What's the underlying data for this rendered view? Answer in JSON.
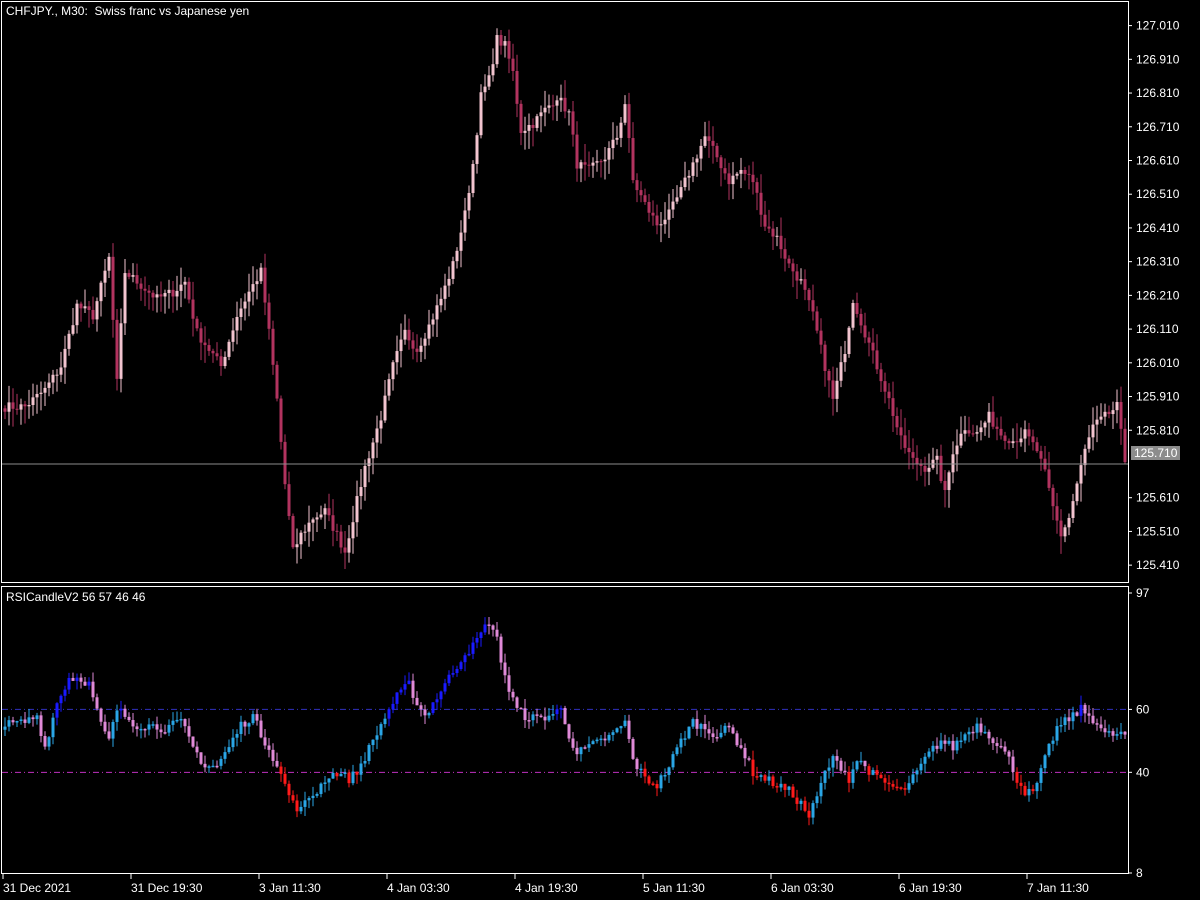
{
  "window": {
    "symbol_label": "CHFJPY., M30:  Swiss franc vs Japanese yen",
    "indicator_label": "RSICandleV2 56 57 46 46",
    "current_price": "125.710",
    "current_price_value": 125.71
  },
  "colors": {
    "background": "#000000",
    "frame": "#ffffff",
    "bull_price": "#f2c4cf",
    "bear_price": "#b2335f",
    "price_line": "#8c8c8c",
    "price_tag_bg": "#8c8c8c",
    "rsi_strong_up": "#1a1aff",
    "rsi_up": "#2aa6e6",
    "rsi_down": "#e08ad8",
    "rsi_strong_down": "#ff1a1a",
    "level_upper": "#3030c0",
    "level_lower": "#c030c0"
  },
  "time_axis": [
    "31 Dec 2021",
    "31 Dec 19:30",
    "3 Jan 11:30",
    "4 Jan 03:30",
    "4 Jan 19:30",
    "5 Jan 11:30",
    "6 Jan 03:30",
    "6 Jan 19:30",
    "7 Jan 11:30"
  ],
  "chart_data": [
    {
      "type": "candlestick",
      "title": "CHFJPY., M30:  Swiss franc vs Japanese yen",
      "y_ticks": [
        "127.010",
        "126.910",
        "126.810",
        "126.710",
        "126.610",
        "126.510",
        "126.410",
        "126.310",
        "126.210",
        "126.110",
        "126.010",
        "125.910",
        "125.810",
        "125.610",
        "125.510",
        "125.410"
      ],
      "ylim": [
        125.36,
        127.08
      ],
      "x_ticks": [
        "31 Dec 2021",
        "31 Dec 19:30",
        "3 Jan 11:30",
        "4 Jan 03:30",
        "4 Jan 19:30",
        "5 Jan 11:30",
        "6 Jan 03:30",
        "6 Jan 19:30",
        "7 Jan 11:30"
      ],
      "close_anchors": [
        [
          0,
          125.88
        ],
        [
          5,
          125.88
        ],
        [
          10,
          125.93
        ],
        [
          14,
          126.0
        ],
        [
          18,
          126.18
        ],
        [
          22,
          126.15
        ],
        [
          26,
          126.32
        ],
        [
          28,
          125.95
        ],
        [
          30,
          126.28
        ],
        [
          33,
          126.25
        ],
        [
          38,
          126.2
        ],
        [
          42,
          126.22
        ],
        [
          45,
          126.25
        ],
        [
          48,
          126.1
        ],
        [
          51,
          126.05
        ],
        [
          54,
          126.0
        ],
        [
          58,
          126.15
        ],
        [
          61,
          126.22
        ],
        [
          64,
          126.28
        ],
        [
          66,
          126.1
        ],
        [
          68,
          125.9
        ],
        [
          70,
          125.65
        ],
        [
          72,
          125.45
        ],
        [
          74,
          125.5
        ],
        [
          77,
          125.55
        ],
        [
          80,
          125.57
        ],
        [
          83,
          125.5
        ],
        [
          85,
          125.45
        ],
        [
          87,
          125.55
        ],
        [
          90,
          125.7
        ],
        [
          94,
          125.85
        ],
        [
          97,
          126.0
        ],
        [
          100,
          126.1
        ],
        [
          103,
          126.05
        ],
        [
          106,
          126.12
        ],
        [
          109,
          126.2
        ],
        [
          112,
          126.3
        ],
        [
          115,
          126.45
        ],
        [
          117,
          126.6
        ],
        [
          119,
          126.8
        ],
        [
          121,
          126.85
        ],
        [
          123,
          126.97
        ],
        [
          125,
          126.95
        ],
        [
          127,
          126.87
        ],
        [
          129,
          126.7
        ],
        [
          132,
          126.72
        ],
        [
          135,
          126.76
        ],
        [
          138,
          126.8
        ],
        [
          141,
          126.75
        ],
        [
          143,
          126.6
        ],
        [
          146,
          126.58
        ],
        [
          150,
          126.62
        ],
        [
          153,
          126.68
        ],
        [
          155,
          126.78
        ],
        [
          157,
          126.55
        ],
        [
          160,
          126.48
        ],
        [
          163,
          126.42
        ],
        [
          166,
          126.45
        ],
        [
          169,
          126.52
        ],
        [
          172,
          126.6
        ],
        [
          175,
          126.68
        ],
        [
          178,
          126.62
        ],
        [
          181,
          126.55
        ],
        [
          184,
          126.58
        ],
        [
          187,
          126.55
        ],
        [
          190,
          126.42
        ],
        [
          193,
          126.38
        ],
        [
          196,
          126.3
        ],
        [
          199,
          126.25
        ],
        [
          202,
          126.15
        ],
        [
          205,
          126.0
        ],
        [
          207,
          125.9
        ],
        [
          210,
          126.05
        ],
        [
          212,
          126.2
        ],
        [
          215,
          126.1
        ],
        [
          218,
          126.0
        ],
        [
          221,
          125.9
        ],
        [
          224,
          125.78
        ],
        [
          227,
          125.72
        ],
        [
          230,
          125.7
        ],
        [
          233,
          125.72
        ],
        [
          235,
          125.62
        ],
        [
          237,
          125.75
        ],
        [
          240,
          125.82
        ],
        [
          243,
          125.8
        ],
        [
          246,
          125.85
        ],
        [
          249,
          125.8
        ],
        [
          252,
          125.78
        ],
        [
          255,
          125.8
        ],
        [
          258,
          125.75
        ],
        [
          260,
          125.68
        ],
        [
          262,
          125.58
        ],
        [
          264,
          125.5
        ],
        [
          266,
          125.55
        ],
        [
          268,
          125.65
        ],
        [
          270,
          125.75
        ],
        [
          272,
          125.82
        ],
        [
          275,
          125.85
        ],
        [
          278,
          125.88
        ],
        [
          280,
          125.72
        ]
      ]
    },
    {
      "type": "colored_bar",
      "title": "RSICandleV2 56 57 46 46",
      "y_ticks": [
        "97",
        "60",
        "40",
        "8"
      ],
      "ylim": [
        8,
        97
      ],
      "levels": [
        60,
        40
      ],
      "close_anchors": [
        [
          0,
          55
        ],
        [
          5,
          56
        ],
        [
          8,
          58
        ],
        [
          10,
          48
        ],
        [
          13,
          62
        ],
        [
          16,
          70
        ],
        [
          19,
          70
        ],
        [
          21,
          68
        ],
        [
          24,
          55
        ],
        [
          26,
          50
        ],
        [
          28,
          60
        ],
        [
          30,
          58
        ],
        [
          33,
          55
        ],
        [
          36,
          55
        ],
        [
          40,
          54
        ],
        [
          44,
          56
        ],
        [
          47,
          48
        ],
        [
          50,
          42
        ],
        [
          53,
          42
        ],
        [
          56,
          48
        ],
        [
          59,
          55
        ],
        [
          62,
          58
        ],
        [
          64,
          52
        ],
        [
          66,
          48
        ],
        [
          68,
          42
        ],
        [
          70,
          36
        ],
        [
          72,
          30
        ],
        [
          74,
          28
        ],
        [
          76,
          32
        ],
        [
          78,
          34
        ],
        [
          80,
          38
        ],
        [
          83,
          40
        ],
        [
          86,
          38
        ],
        [
          88,
          40
        ],
        [
          90,
          45
        ],
        [
          92,
          50
        ],
        [
          94,
          55
        ],
        [
          96,
          60
        ],
        [
          98,
          64
        ],
        [
          101,
          68
        ],
        [
          103,
          62
        ],
        [
          105,
          58
        ],
        [
          107,
          62
        ],
        [
          109,
          66
        ],
        [
          111,
          70
        ],
        [
          113,
          74
        ],
        [
          115,
          78
        ],
        [
          117,
          80
        ],
        [
          119,
          84
        ],
        [
          121,
          88
        ],
        [
          123,
          82
        ],
        [
          124,
          76
        ],
        [
          126,
          66
        ],
        [
          128,
          60
        ],
        [
          130,
          58
        ],
        [
          133,
          57
        ],
        [
          136,
          58
        ],
        [
          139,
          60
        ],
        [
          141,
          52
        ],
        [
          143,
          46
        ],
        [
          146,
          48
        ],
        [
          149,
          50
        ],
        [
          152,
          52
        ],
        [
          155,
          56
        ],
        [
          157,
          44
        ],
        [
          160,
          38
        ],
        [
          163,
          36
        ],
        [
          166,
          42
        ],
        [
          169,
          50
        ],
        [
          172,
          56
        ],
        [
          175,
          54
        ],
        [
          178,
          52
        ],
        [
          181,
          54
        ],
        [
          184,
          48
        ],
        [
          187,
          40
        ],
        [
          190,
          38
        ],
        [
          193,
          36
        ],
        [
          196,
          34
        ],
        [
          199,
          30
        ],
        [
          201,
          26
        ],
        [
          203,
          32
        ],
        [
          205,
          40
        ],
        [
          207,
          44
        ],
        [
          209,
          42
        ],
        [
          211,
          38
        ],
        [
          213,
          44
        ],
        [
          215,
          42
        ],
        [
          218,
          38
        ],
        [
          221,
          36
        ],
        [
          224,
          34
        ],
        [
          226,
          36
        ],
        [
          228,
          40
        ],
        [
          231,
          46
        ],
        [
          234,
          50
        ],
        [
          237,
          48
        ],
        [
          240,
          52
        ],
        [
          243,
          55
        ],
        [
          246,
          52
        ],
        [
          249,
          48
        ],
        [
          251,
          44
        ],
        [
          253,
          38
        ],
        [
          255,
          34
        ],
        [
          257,
          33
        ],
        [
          259,
          40
        ],
        [
          261,
          48
        ],
        [
          263,
          54
        ],
        [
          265,
          56
        ],
        [
          267,
          58
        ],
        [
          269,
          60
        ],
        [
          271,
          58
        ],
        [
          273,
          56
        ],
        [
          275,
          52
        ]
      ]
    }
  ]
}
